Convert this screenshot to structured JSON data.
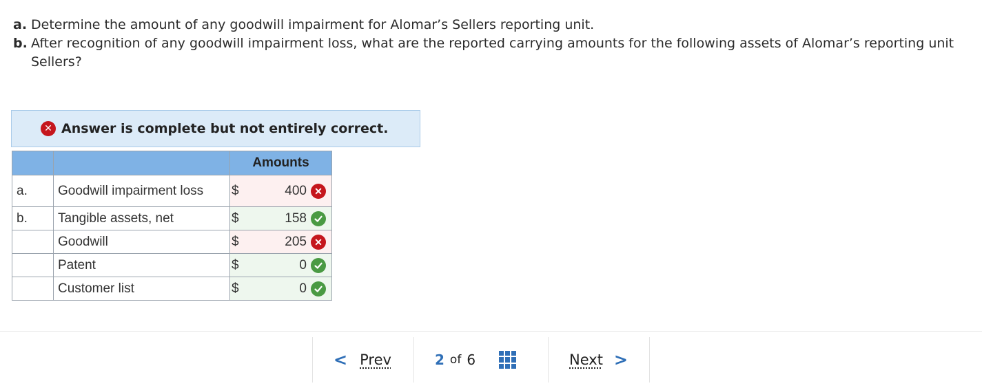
{
  "question": {
    "a_letter": "a.",
    "a_text": "Determine the amount of any goodwill impairment for Alomar’s Sellers reporting unit.",
    "b_letter": "b.",
    "b_text": "After recognition of any goodwill impairment loss, what are the reported carrying amounts for the following assets of Alomar’s reporting unit Sellers?"
  },
  "banner": {
    "text": "Answer is complete but not entirely correct.",
    "icon": "x-circle-icon",
    "color": "#c5161d"
  },
  "table": {
    "header": "Amounts",
    "currency": "$",
    "rows": [
      {
        "letter": "a.",
        "label": "Goodwill impairment loss",
        "amount": "400",
        "status": "incorrect"
      },
      {
        "letter": "b.",
        "label": "Tangible assets, net",
        "amount": "158",
        "status": "correct"
      },
      {
        "letter": "",
        "label": "Goodwill",
        "amount": "205",
        "status": "incorrect"
      },
      {
        "letter": "",
        "label": "Patent",
        "amount": "0",
        "status": "correct"
      },
      {
        "letter": "",
        "label": "Customer list",
        "amount": "0",
        "status": "correct"
      }
    ]
  },
  "pager": {
    "prev": "Prev",
    "current": "2",
    "of": "of",
    "total": "6",
    "next": "Next"
  },
  "colors": {
    "header_bg": "#7fb2e5",
    "banner_bg": "#dcebf8",
    "correct": "#4a9a43",
    "incorrect": "#c5161d",
    "accent": "#2f6fb7"
  }
}
